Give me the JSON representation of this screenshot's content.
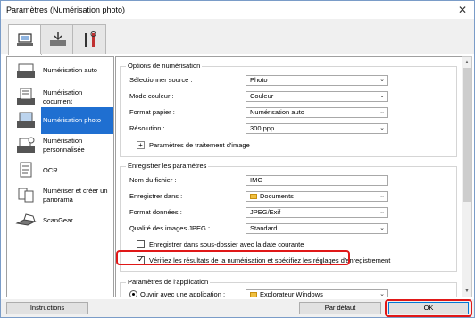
{
  "window": {
    "title": "Paramètres (Numérisation photo)",
    "close_glyph": "✕"
  },
  "tabs": [
    {
      "name": "scan-from-computer-tab",
      "icon": "computer-scan-icon"
    },
    {
      "name": "scan-from-panel-tab",
      "icon": "panel-scan-icon"
    },
    {
      "name": "general-settings-tab",
      "icon": "tools-icon"
    }
  ],
  "sidebar": {
    "items": [
      {
        "label": "Numérisation auto",
        "icon": "auto-scan-icon"
      },
      {
        "label": "Numérisation document",
        "icon": "document-scan-icon"
      },
      {
        "label": "Numérisation photo",
        "icon": "photo-scan-icon"
      },
      {
        "label": "Numérisation personnalisée",
        "icon": "custom-scan-icon"
      },
      {
        "label": "OCR",
        "icon": "ocr-icon"
      },
      {
        "label": "Numériser et créer un panorama",
        "icon": "panorama-icon"
      },
      {
        "label": "ScanGear",
        "icon": "scangear-icon"
      }
    ],
    "active_index": 2
  },
  "scan_options": {
    "title": "Options de numérisation",
    "source": {
      "label": "Sélectionner source :",
      "value": "Photo"
    },
    "color_mode": {
      "label": "Mode couleur :",
      "value": "Couleur"
    },
    "paper_size": {
      "label": "Format papier :",
      "value": "Numérisation auto"
    },
    "resolution": {
      "label": "Résolution :",
      "value": "300 ppp"
    },
    "image_processing": {
      "label": "Paramètres de traitement d'image",
      "toggle": "+"
    }
  },
  "save_settings": {
    "title": "Enregistrer les paramètres",
    "file_name": {
      "label": "Nom du fichier :",
      "value": "IMG"
    },
    "save_in": {
      "label": "Enregistrer dans :",
      "value": "Documents"
    },
    "data_format": {
      "label": "Format données :",
      "value": "JPEG/Exif"
    },
    "jpeg_quality": {
      "label": "Qualité des images JPEG :",
      "value": "Standard"
    },
    "subfolder": {
      "label": "Enregistrer dans sous-dossier avec la date courante",
      "checked": false
    },
    "verify": {
      "label": "Vérifiez les résultats de la numérisation et spécifiez les réglages d'enregistrement",
      "checked": true
    }
  },
  "app_settings": {
    "title": "Paramètres de l'application",
    "open_with": {
      "label": "Ouvrir avec une application :",
      "value": "Explorateur Windows"
    }
  },
  "footer": {
    "instructions": "Instructions",
    "defaults": "Par défaut",
    "ok": "OK"
  },
  "colors": {
    "accent": "#1f6fd1",
    "highlight": "#e01818"
  }
}
